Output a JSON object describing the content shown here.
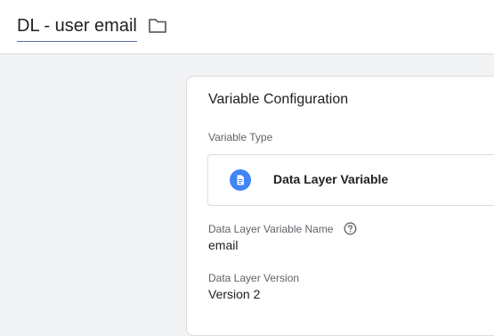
{
  "header": {
    "variable_name": "DL - user email",
    "folder_icon": "folder-icon"
  },
  "card": {
    "title": "Variable Configuration",
    "variable_type_label": "Variable Type",
    "variable_type_value": "Data Layer Variable",
    "variable_type_icon": "document-icon",
    "dl_name_label": "Data Layer Variable Name",
    "dl_name_help_icon": "help-icon",
    "dl_name_value": "email",
    "dl_version_label": "Data Layer Version",
    "dl_version_value": "Version 2"
  },
  "colors": {
    "accent": "#4285f4",
    "title_underline": "#5b6bb3",
    "background": "#f1f3f4"
  }
}
